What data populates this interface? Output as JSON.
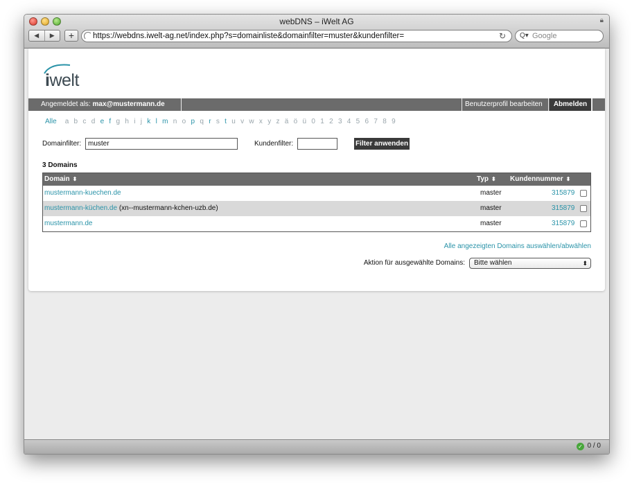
{
  "window": {
    "title": "webDNS – iWelt AG"
  },
  "browser": {
    "back": "◀",
    "forward": "▶",
    "add": "+",
    "url": "https://webdns.iwelt-ag.net/index.php?s=domainliste&domainfilter=muster&kundenfilter=",
    "reload": "↻",
    "search_placeholder": "Google",
    "status_count": "0 / 0"
  },
  "logo": {
    "bold": "i",
    "rest": "welt"
  },
  "userbar": {
    "logged_in_label": "Angemeldet als:",
    "user": "max@mustermann.de",
    "profile": "Benutzerprofil bearbeiten",
    "logout": "Abmelden"
  },
  "alphabet": {
    "all": "Alle",
    "letters": [
      "a",
      "b",
      "c",
      "d",
      "e",
      "f",
      "g",
      "h",
      "i",
      "j",
      "k",
      "l",
      "m",
      "n",
      "o",
      "p",
      "q",
      "r",
      "s",
      "t",
      "u",
      "v",
      "w",
      "x",
      "y",
      "z",
      "ä",
      "ö",
      "ü",
      "0",
      "1",
      "2",
      "3",
      "4",
      "5",
      "6",
      "7",
      "8",
      "9"
    ],
    "active": [
      "e",
      "f",
      "k",
      "l",
      "m",
      "p",
      "r",
      "t"
    ]
  },
  "filters": {
    "domain_label": "Domainfilter:",
    "domain_value": "muster",
    "customer_label": "Kundenfilter:",
    "customer_value": "",
    "apply": "Filter anwenden"
  },
  "result_count": "3 Domains",
  "table": {
    "headers": {
      "domain": "Domain",
      "type": "Typ",
      "customer": "Kundennummer"
    },
    "sort_icon": "⬍",
    "rows": [
      {
        "domain": "mustermann-kuechen.de",
        "extra": "",
        "type": "master",
        "customer": "315879"
      },
      {
        "domain": "mustermann-küchen.de",
        "extra": " (xn--mustermann-kchen-uzb.de)",
        "type": "master",
        "customer": "315879"
      },
      {
        "domain": "mustermann.de",
        "extra": "",
        "type": "master",
        "customer": "315879"
      }
    ]
  },
  "select_all": "Alle angezeigten Domains auswählen/abwählen",
  "action": {
    "label": "Aktion für ausgewählte Domains:",
    "selected": "Bitte wählen"
  },
  "colors": {
    "link": "#2a93a8",
    "bar": "#6b6b6b",
    "button": "#3a3a3a"
  }
}
